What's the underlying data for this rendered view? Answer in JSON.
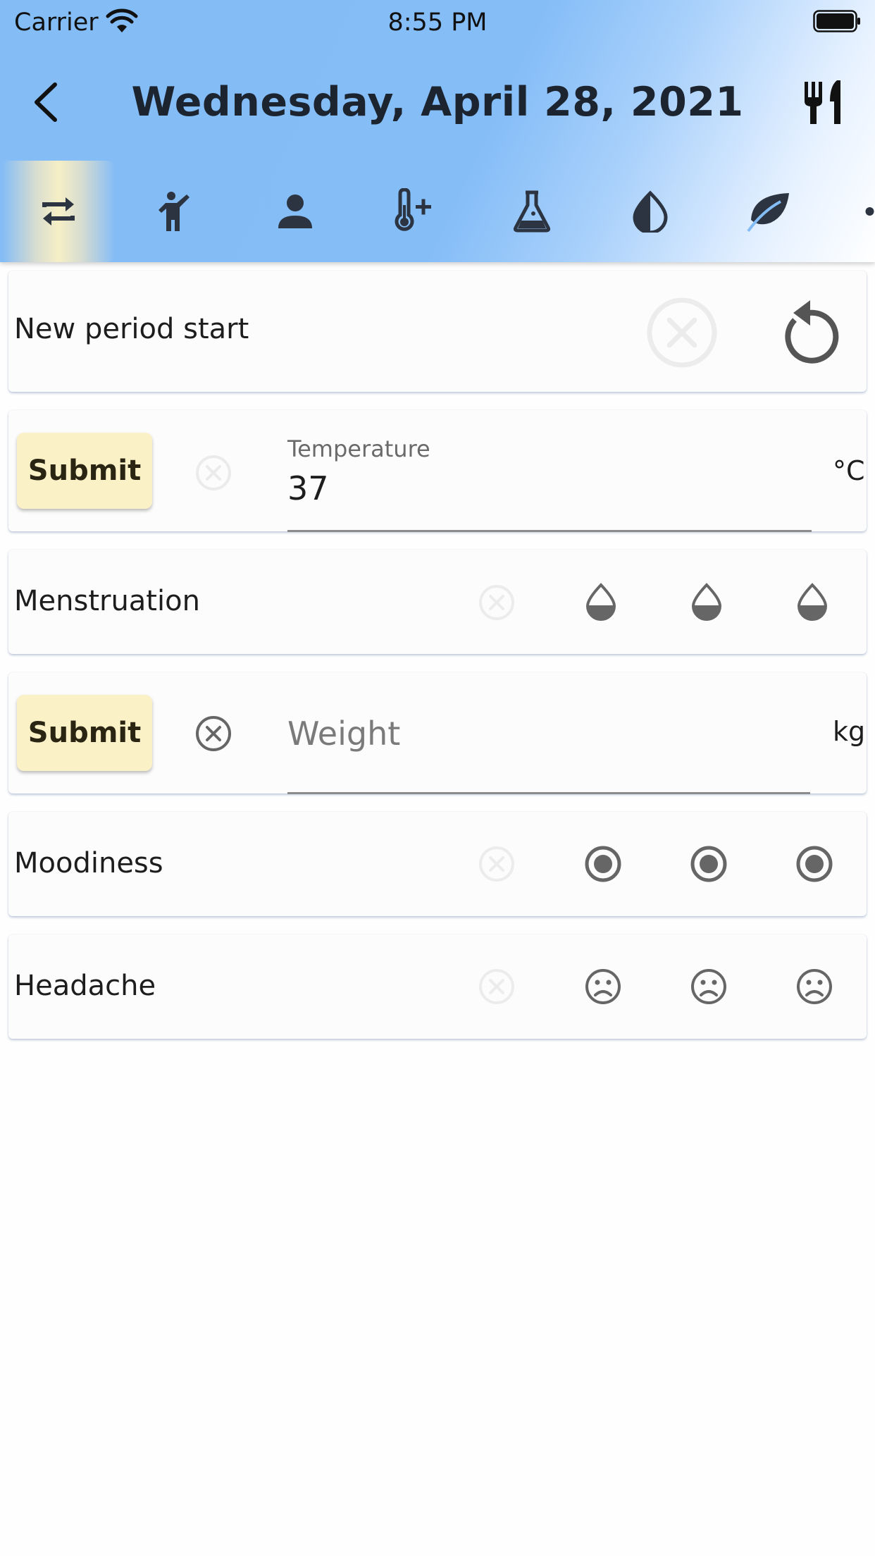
{
  "status_bar": {
    "carrier": "Carrier",
    "time": "8:55 PM"
  },
  "header": {
    "title": "Wednesday, April 28, 2021",
    "back_icon": "chevron-left-icon",
    "right_icon": "food-utensils-icon"
  },
  "tabs": [
    {
      "icon": "repeat-icon",
      "active": true
    },
    {
      "icon": "person-waving-icon",
      "active": false
    },
    {
      "icon": "person-icon",
      "active": false
    },
    {
      "icon": "thermometer-plus-icon",
      "active": false
    },
    {
      "icon": "flask-icon",
      "active": false
    },
    {
      "icon": "half-drop-icon",
      "active": false
    },
    {
      "icon": "leaf-icon",
      "active": false
    },
    {
      "icon": "partial-circle-icon",
      "active": false
    }
  ],
  "cards": {
    "period": {
      "label": "New period start"
    },
    "temperature": {
      "submit": "Submit",
      "label": "Temperature",
      "value": "37",
      "unit": "°C"
    },
    "menstruation": {
      "label": "Menstruation"
    },
    "weight": {
      "submit": "Submit",
      "placeholder": "Weight",
      "unit": "kg"
    },
    "moodiness": {
      "label": "Moodiness"
    },
    "headache": {
      "label": "Headache"
    }
  },
  "colors": {
    "header_start": "#84bcf6",
    "submit_bg": "#fbf1c7",
    "icon_dark": "#2b3440",
    "icon_gray": "#6b6b6b"
  }
}
